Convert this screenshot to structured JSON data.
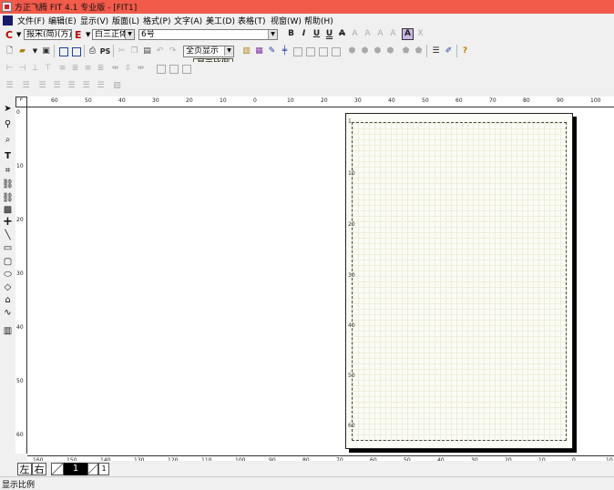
{
  "window": {
    "title": "方正飞腾 FIT 4.1 专业版 - [FIT1]"
  },
  "menu": [
    "文件(F)",
    "编辑(E)",
    "显示(V)",
    "版面(L)",
    "格式(P)",
    "文字(A)",
    "美工(D)",
    "表格(T)",
    "视窗(W)",
    "帮助(H)"
  ],
  "format_bar": {
    "c_label": "C",
    "e_label": "E",
    "chinese_font": "报宋(简)(方正)",
    "english_font": "白三正体",
    "font_size": "6号",
    "style_buttons": [
      "B",
      "I",
      "U",
      "U",
      "A",
      "A",
      "A",
      "A",
      "A",
      "X"
    ]
  },
  "standard_bar": {
    "zoom": "全页显示",
    "tooltip": "显示比例"
  },
  "rulers": {
    "top": [
      "60",
      "50",
      "40",
      "30",
      "20",
      "10",
      "0",
      "10",
      "20",
      "30",
      "40",
      "50",
      "60",
      "70",
      "80",
      "90",
      "100"
    ],
    "left": [
      "0",
      "10",
      "20",
      "30",
      "40",
      "50",
      "60"
    ],
    "bottom": [
      "160",
      "150",
      "140",
      "130",
      "120",
      "110",
      "100",
      "90",
      "80",
      "70",
      "60",
      "50",
      "40",
      "30",
      "20",
      "10",
      "0",
      "10"
    ],
    "page_vertical": [
      "10",
      "20",
      "30",
      "40",
      "50",
      "60"
    ]
  },
  "bottom_bar": {
    "left_page": "左",
    "right_page": "右",
    "current_page": "1",
    "next_page": "1"
  },
  "status": {
    "text": "显示比例"
  },
  "colors": {
    "titlebar": "#f25a4a",
    "chrome": "#f0f0f0",
    "page": "#fcfcf6"
  }
}
